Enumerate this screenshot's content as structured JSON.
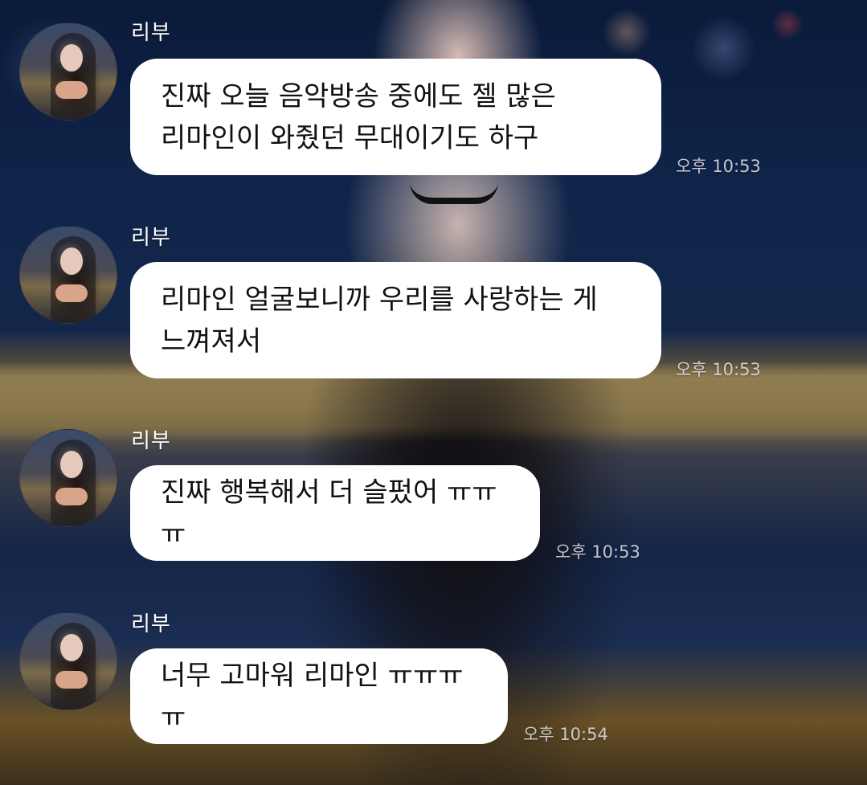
{
  "messages": [
    {
      "sender": "리부",
      "text": "진짜 오늘 음악방송 중에도 젤 많은\n리마인이 와줬던 무대이기도 하구",
      "time": "오후 10:53"
    },
    {
      "sender": "리부",
      "text": "리마인 얼굴보니까 우리를 사랑하는 게\n느껴져서",
      "time": "오후 10:53"
    },
    {
      "sender": "리부",
      "text": "진짜 행복해서 더 슬펐어 ㅠㅠㅠ",
      "time": "오후 10:53"
    },
    {
      "sender": "리부",
      "text": "너무 고마워 리마인 ㅠㅠㅠㅠ",
      "time": "오후 10:54"
    }
  ]
}
